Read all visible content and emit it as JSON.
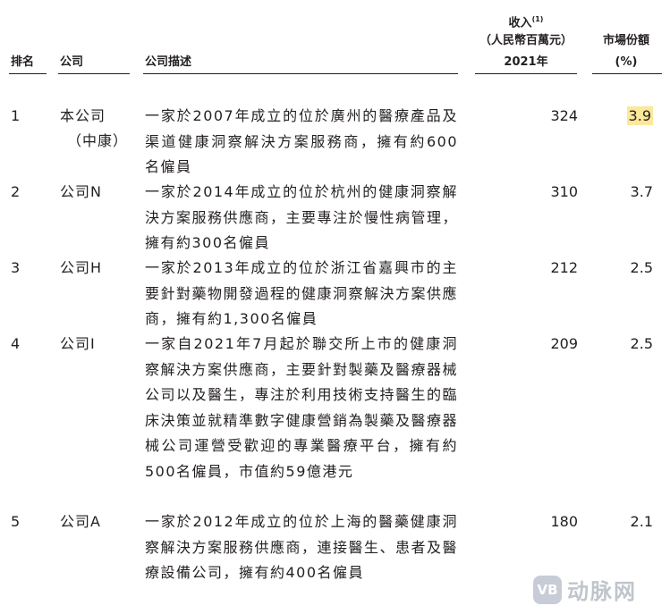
{
  "header": {
    "rank": "排名",
    "company": "公司",
    "description": "公司描述",
    "revenue_line1": "收入",
    "revenue_note": "(1)",
    "revenue_line2": "（人民幣百萬元）",
    "revenue_line3": "2021年",
    "share_line1": "市場份額",
    "share_line2": "(%)"
  },
  "rows": [
    {
      "rank": "1",
      "company_line1": "本公司",
      "company_line2": "（中康）",
      "description": "一家於2007年成立的位於廣州的醫療產品及渠道健康洞察解決方案服務商，擁有約600名僱員",
      "revenue": "324",
      "share": "3.9"
    },
    {
      "rank": "2",
      "company_line1": "公司N",
      "company_line2": "",
      "description": "一家於2014年成立的位於杭州的健康洞察解決方案服務供應商，主要專注於慢性病管理，擁有約300名僱員",
      "revenue": "310",
      "share": "3.7"
    },
    {
      "rank": "3",
      "company_line1": "公司H",
      "company_line2": "",
      "description": "一家於2013年成立的位於浙江省嘉興市的主要針對藥物開發過程的健康洞察解決方案供應商，擁有約1,300名僱員",
      "revenue": "212",
      "share": "2.5"
    },
    {
      "rank": "4",
      "company_line1": "公司I",
      "company_line2": "",
      "description": "一家自2021年7月起於聯交所上市的健康洞察解決方案供應商，主要針對製藥及醫療器械公司以及醫生，專注於利用技術支持醫生的臨床決策並就精準數字健康營銷為製藥及醫療器械公司運營受歡迎的專業醫療平台，擁有約500名僱員，市值約59億港元",
      "revenue": "209",
      "share": "2.5"
    },
    {
      "rank": "5",
      "company_line1": "公司A",
      "company_line2": "",
      "description": "一家於2012年成立的位於上海的醫藥健康洞察解決方案服務供應商，連接醫生、患者及醫療設備公司，擁有約400名僱員",
      "revenue": "180",
      "share": "2.1"
    }
  ],
  "watermark": {
    "logo": "VB",
    "text": "动脉网"
  }
}
